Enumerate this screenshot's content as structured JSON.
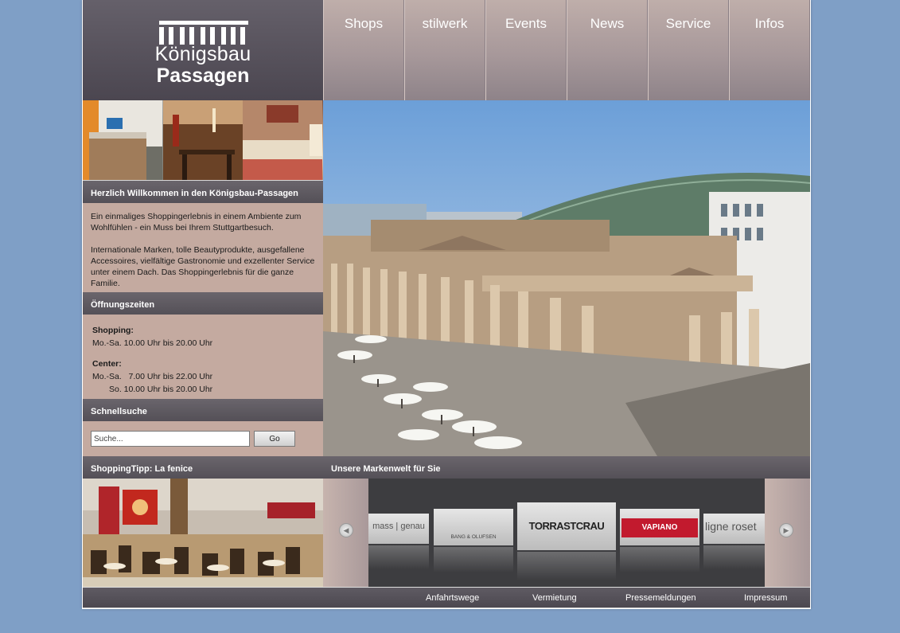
{
  "logo": {
    "line1": "Königsbau",
    "line2": "Passagen"
  },
  "nav": {
    "items": [
      {
        "label": "Shops"
      },
      {
        "label": "stilwerk"
      },
      {
        "label": "Events"
      },
      {
        "label": "News"
      },
      {
        "label": "Service"
      },
      {
        "label": "Infos"
      }
    ]
  },
  "welcome": {
    "title": "Herzlich Willkommen in den Königsbau-Passagen",
    "para1": "Ein einmaliges Shoppingerlebnis in einem Ambiente zum Wohlfühlen - ein Muss bei Ihrem Stuttgartbesuch.",
    "para2": "Internationale Marken, tolle Beautyprodukte, ausgefallene Accessoires, vielfältige Gastronomie und exzellenter Service unter einem Dach. Das Shoppingerlebnis für die ganze Familie."
  },
  "hours": {
    "title": "Öffnungszeiten",
    "shopping_label": "Shopping:",
    "shopping_line": "Mo.-Sa. 10.00 Uhr bis 20.00 Uhr",
    "center_label": "Center:",
    "center_line1": "Mo.-Sa.   7.00 Uhr bis 22.00 Uhr",
    "center_line2": "So. 10.00 Uhr bis 20.00 Uhr"
  },
  "search": {
    "title": "Schnellsuche",
    "value": "Suche...",
    "button": "Go"
  },
  "tip": {
    "title": "ShoppingTipp: La fenice"
  },
  "brands": {
    "title": "Unsere Markenwelt für Sie",
    "items": [
      "mass | genau",
      "BANG & OLUFSEN",
      "TORRASTCRAU",
      "VAPIANO",
      "ligne roset"
    ]
  },
  "footer": {
    "links": [
      "Anfahrtswege",
      "Vermietung",
      "Pressemeldungen",
      "Impressum"
    ]
  },
  "colors": {
    "background": "#7f9fc6",
    "header_bar": "#545057",
    "content_box": "#c4aaa0",
    "nav_tile": "#a7989a"
  }
}
